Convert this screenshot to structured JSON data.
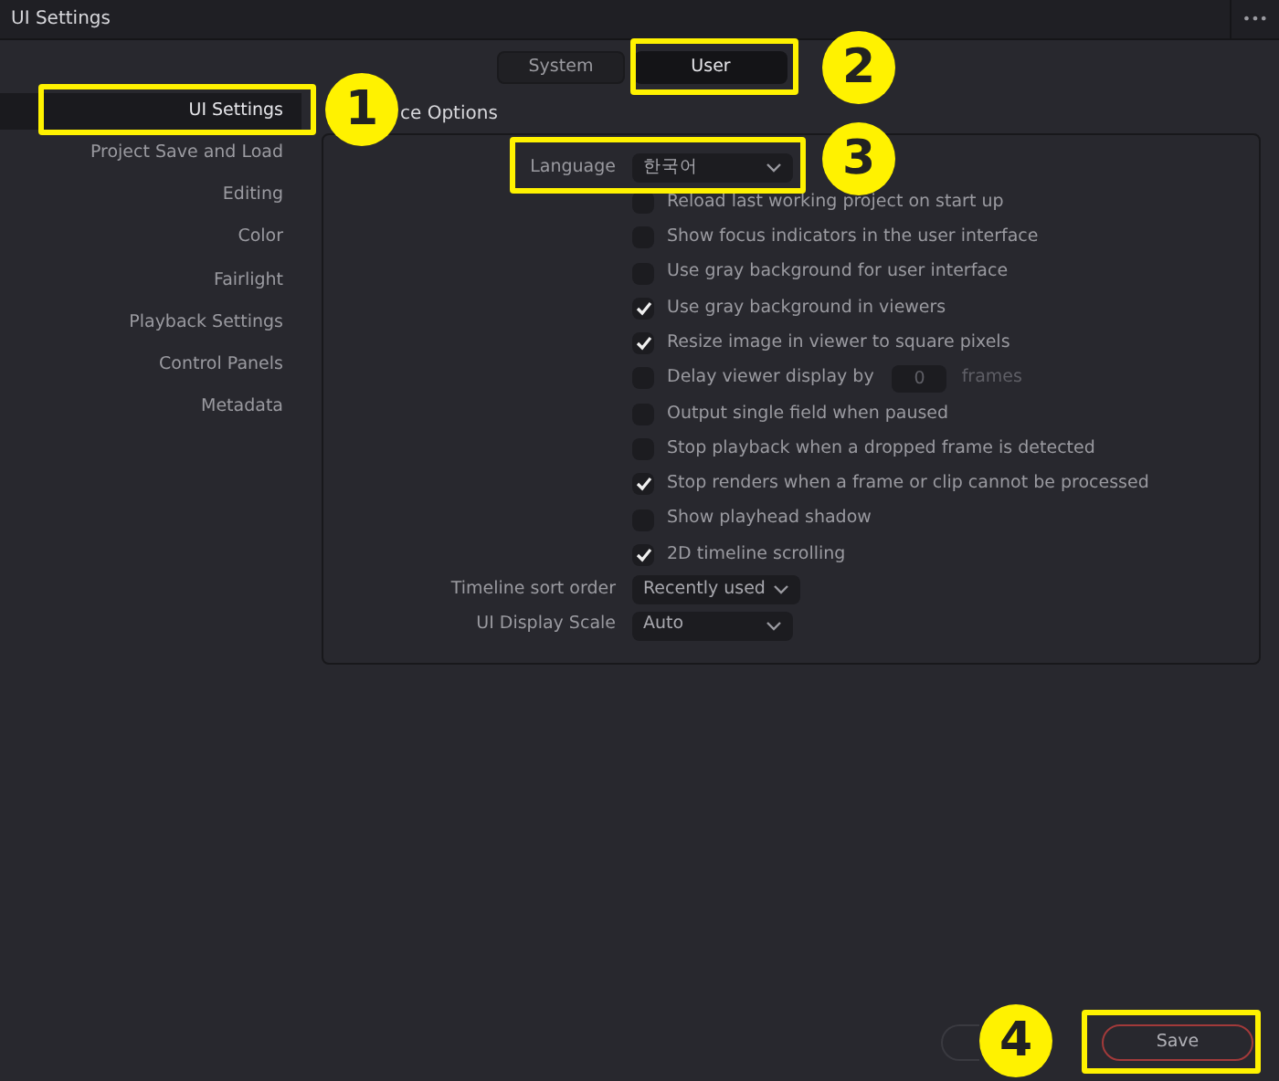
{
  "window": {
    "title": "UI Settings",
    "menu_glyph": "•••"
  },
  "tabs": [
    {
      "label": "System",
      "selected": false
    },
    {
      "label": "User",
      "selected": true
    }
  ],
  "sidebar": {
    "items": [
      {
        "label": "UI Settings",
        "selected": true
      },
      {
        "label": "Project Save and Load",
        "selected": false
      },
      {
        "label": "Editing",
        "selected": false
      },
      {
        "label": "Color",
        "selected": false
      },
      {
        "label": "Fairlight",
        "selected": false
      },
      {
        "label": "Playback Settings",
        "selected": false
      },
      {
        "label": "Control Panels",
        "selected": false
      },
      {
        "label": "Metadata",
        "selected": false
      }
    ]
  },
  "section": {
    "title": "ce Options"
  },
  "rows": [
    {
      "kind": "dropdown",
      "label": "Language",
      "value": "한국어"
    },
    {
      "kind": "checkbox",
      "label": "Reload last working project on start up",
      "checked": false
    },
    {
      "kind": "checkbox",
      "label": "Show focus indicators in the user interface",
      "checked": false
    },
    {
      "kind": "checkbox",
      "label": "Use gray background for user interface",
      "checked": false
    },
    {
      "kind": "checkbox",
      "label": "Use gray background in viewers",
      "checked": true
    },
    {
      "kind": "checkbox",
      "label": "Resize image in viewer to square pixels",
      "checked": true
    },
    {
      "kind": "checkbox",
      "label": "Delay viewer display by",
      "checked": false,
      "input": "0",
      "unit": "frames"
    },
    {
      "kind": "checkbox",
      "label": "Output single field when paused",
      "checked": false
    },
    {
      "kind": "checkbox",
      "label": "Stop playback when a dropped frame is detected",
      "checked": false
    },
    {
      "kind": "checkbox",
      "label": "Stop renders when a frame or clip cannot be processed",
      "checked": true
    },
    {
      "kind": "checkbox",
      "label": "Show playhead shadow",
      "checked": false
    },
    {
      "kind": "checkbox",
      "label": "2D timeline scrolling",
      "checked": true
    },
    {
      "kind": "dropdown",
      "label": "Timeline sort order",
      "value": "Recently used"
    },
    {
      "kind": "dropdown",
      "label": "UI Display Scale",
      "value": "Auto"
    }
  ],
  "footer": {
    "save": "Save"
  },
  "annotations": [
    {
      "label": "1"
    },
    {
      "label": "2"
    },
    {
      "label": "3"
    },
    {
      "label": "4"
    }
  ]
}
